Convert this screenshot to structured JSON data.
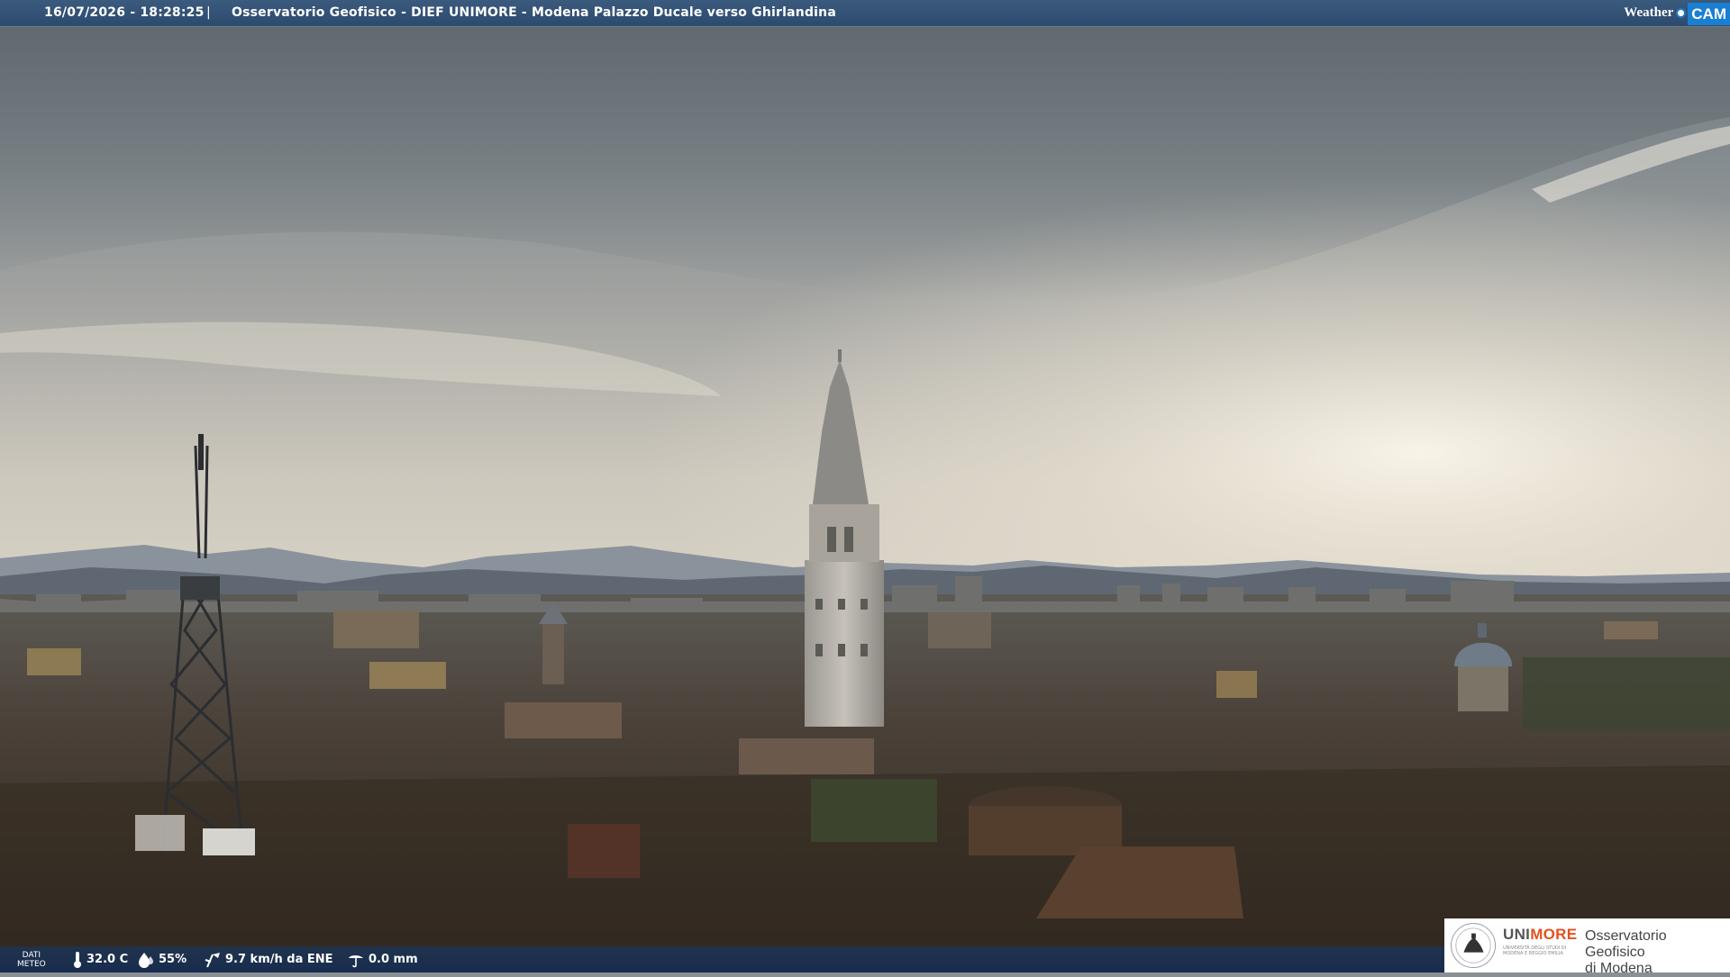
{
  "header": {
    "datetime": "16/07/2026 - 18:28:25",
    "separator": "|",
    "title": "Osservatorio Geofisico - DIEF UNIMORE - Modena Palazzo Ducale verso Ghirlandina",
    "brand_weather": "Weather",
    "brand_cam": "CAM"
  },
  "footer": {
    "dati_line1": "DATI",
    "dati_line2": "METEO",
    "temperature": "32.0 C",
    "humidity": "55%",
    "wind": "9.7 km/h da ENE",
    "rain": "0.0 mm",
    "icons": [
      "thermometer-icon",
      "humidity-drop-icon",
      "wind-icon",
      "rain-gauge-icon"
    ]
  },
  "logo": {
    "uni_prefix": "UNI",
    "uni_suffix": "MORE",
    "uni_sub": "UNIVERSITÀ DEGLI STUDI DI MODENA E REGGIO EMILIA",
    "observatory_line1": "Osservatorio Geofisico",
    "observatory_line2": "di Modena"
  },
  "colors": {
    "header_bar": "#2f4f75",
    "cam_badge": "#1a7fd0",
    "unimore_accent": "#e1521f"
  }
}
